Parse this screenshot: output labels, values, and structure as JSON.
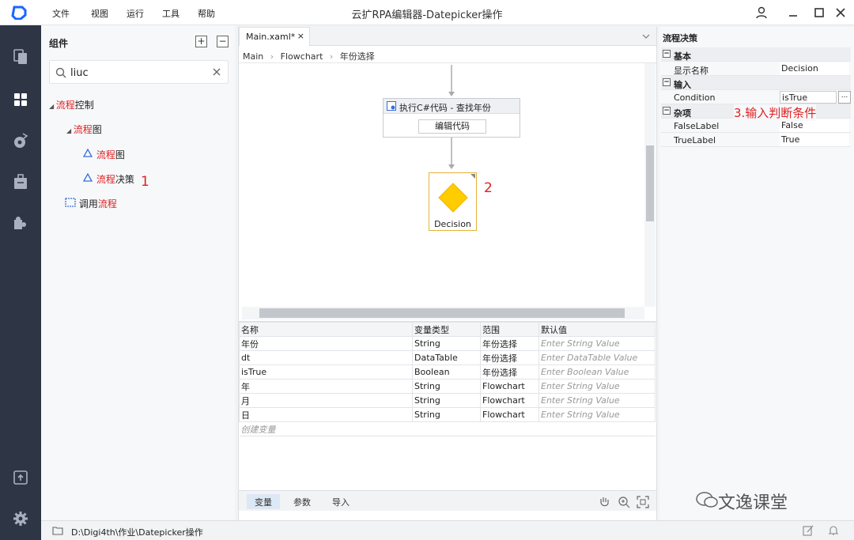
{
  "app": {
    "title": "云扩RPA编辑器-Datepicker操作"
  },
  "menu": [
    "文件",
    "视图",
    "运行",
    "工具",
    "帮助"
  ],
  "panel": {
    "title": "组件",
    "search_value": "liuc"
  },
  "tree": {
    "n1": {
      "hl": "流程",
      "rest": "控制"
    },
    "n2": {
      "hl": "流程",
      "rest": "图"
    },
    "n3": {
      "hl": "流程",
      "rest": "图"
    },
    "n4": {
      "hl": "流程",
      "rest": "决策"
    },
    "n5": {
      "pre": "调用",
      "hl": "流程"
    }
  },
  "annotations": {
    "a1": "1",
    "a2": "2",
    "a3": "3.输入判断条件"
  },
  "editor": {
    "tab": "Main.xaml*",
    "breadcrumb": [
      "Main",
      "Flowchart",
      "年份选择"
    ],
    "activity": {
      "title": "执行C#代码 - 查找年份",
      "button": "编辑代码"
    },
    "decision": {
      "label": "Decision"
    }
  },
  "variables": {
    "headers": [
      "名称",
      "变量类型",
      "范围",
      "默认值"
    ],
    "rows": [
      [
        "年份",
        "String",
        "年份选择",
        "Enter String Value"
      ],
      [
        "dt",
        "DataTable",
        "年份选择",
        "Enter DataTable Value"
      ],
      [
        "isTrue",
        "Boolean",
        "年份选择",
        "Enter Boolean Value"
      ],
      [
        "年",
        "String",
        "Flowchart",
        "Enter String Value"
      ],
      [
        "月",
        "String",
        "Flowchart",
        "Enter String Value"
      ],
      [
        "日",
        "String",
        "Flowchart",
        "Enter String Value"
      ]
    ],
    "create": "创建变量",
    "tabs": [
      "变量",
      "参数",
      "导入"
    ]
  },
  "props": {
    "title": "流程决策",
    "s1": "基本",
    "display_name_label": "显示名称",
    "display_name": "Decision",
    "s2": "输入",
    "condition_label": "Condition",
    "condition": "isTrue",
    "ellipsis": "...",
    "s3": "杂项",
    "false_label_label": "FalseLabel",
    "false_label": "False",
    "true_label_label": "TrueLabel",
    "true_label": "True"
  },
  "status": {
    "path": "D:\\Digi4th\\作业\\Datepicker操作"
  },
  "watermark": "文逸课堂",
  "colors": {
    "sidebar": "#2e3545",
    "accent": "#e02020",
    "decision": "#ffcc00",
    "active_tab": "#dde8f5"
  }
}
